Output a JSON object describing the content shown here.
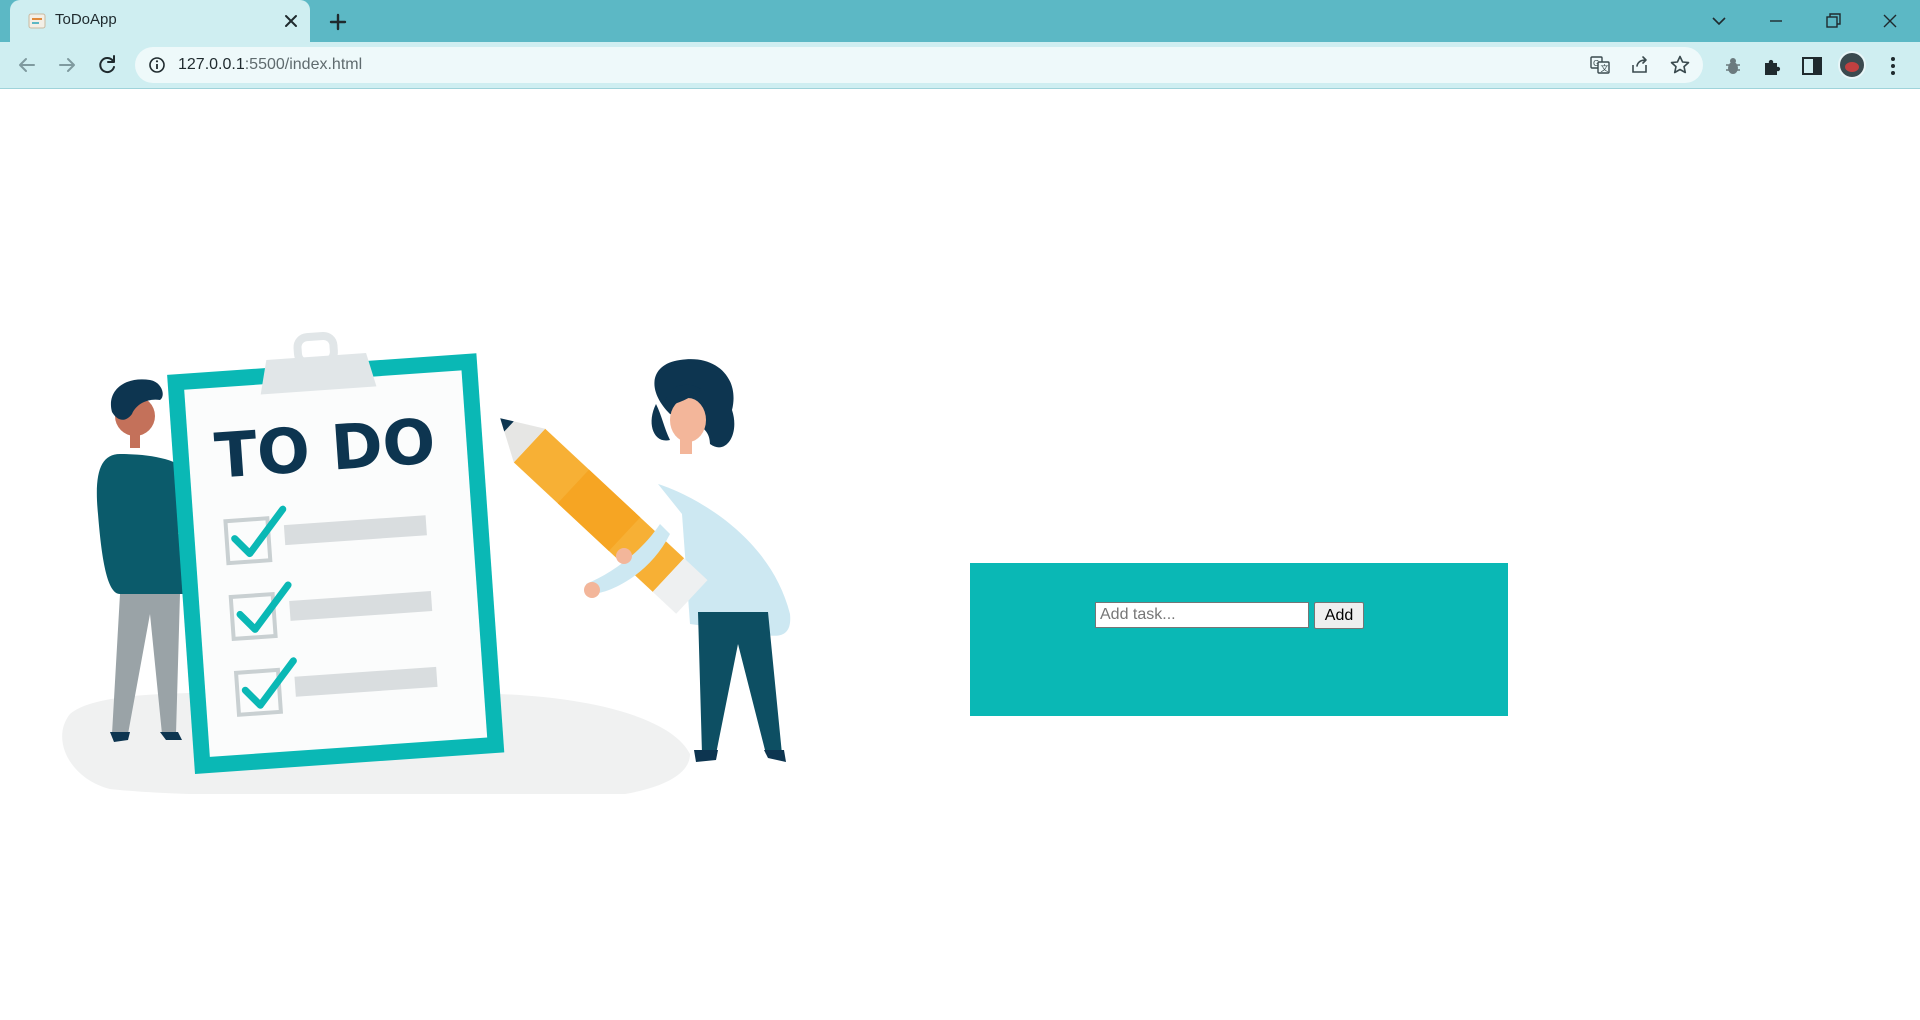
{
  "browser": {
    "tab_title": "ToDoApp",
    "url_host": "127.0.0.1",
    "url_path": ":5500/index.html",
    "accent": "#5cb8c5",
    "toolbar_bg": "#cfeef1"
  },
  "page": {
    "illustration": {
      "heading": "TO DO"
    },
    "todo": {
      "input_placeholder": "Add task...",
      "input_value": "",
      "add_label": "Add",
      "card_color": "#0ab8b5",
      "tasks": []
    }
  }
}
